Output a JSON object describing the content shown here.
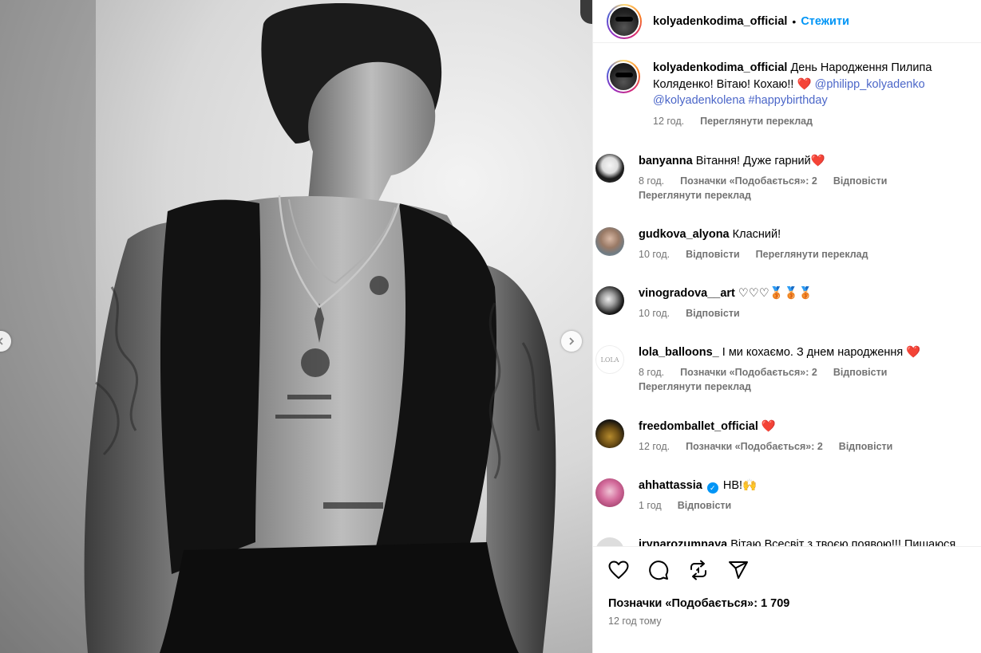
{
  "post": {
    "author": "kolyadenkodima_official",
    "separator": "•",
    "follow_label": "Стежити",
    "caption_text": "День Народження Пилипа Коляденко! Вітаю! Кохаю!! ",
    "caption_emoji": "❤️",
    "caption_mentions": [
      "@philipp_kolyadenko",
      "@kolyadenkolena"
    ],
    "caption_hashtag": "#happybirthday",
    "caption_time": "12 год.",
    "caption_translate": "Переглянути переклад"
  },
  "comments": [
    {
      "username": "banyanna",
      "text": "Вітання! Дуже гарний",
      "emoji": "❤️",
      "time": "8 год.",
      "likes": "Позначки «Подобається»: 2",
      "reply": "Відповісти",
      "translate": "Переглянути переклад"
    },
    {
      "username": "gudkova_alyona",
      "text": "Класний!",
      "time": "10 год.",
      "reply": "Відповісти",
      "translate": "Переглянути переклад"
    },
    {
      "username": "vinogradova__art",
      "text": "♡♡♡🥉🥉🥉",
      "time": "10 год.",
      "reply": "Відповісти"
    },
    {
      "username": "lola_balloons_",
      "text": "І ми кохаємо. З днем народження",
      "emoji": "❤️",
      "time": "8 год.",
      "likes": "Позначки «Подобається»: 2",
      "reply": "Відповісти",
      "translate": "Переглянути переклад",
      "avatar_text": "LOLA"
    },
    {
      "username": "freedomballet_official",
      "text": "",
      "emoji": "❤️",
      "time": "12 год.",
      "likes": "Позначки «Подобається»: 2",
      "reply": "Відповісти"
    },
    {
      "username": "ahhattassia",
      "text": "НВ!",
      "emoji": "🙌",
      "time": "1 год",
      "reply": "Відповісти"
    },
    {
      "username": "irynarozumnaya",
      "text": "Вітаю Всесвіт з твоєю появою!!! Пишаюся"
    }
  ],
  "footer": {
    "likes": "Позначки «Подобається»: 1 709",
    "time_ago": "12 год тому"
  },
  "colors": {
    "link": "#0095f6",
    "mention": "#4b66c8",
    "heart": "#e0202b",
    "muted": "#737373"
  },
  "icons": [
    "chevron-left-icon",
    "chevron-right-icon",
    "heart-icon",
    "comment-icon",
    "repost-icon",
    "share-icon",
    "verified-icon"
  ]
}
